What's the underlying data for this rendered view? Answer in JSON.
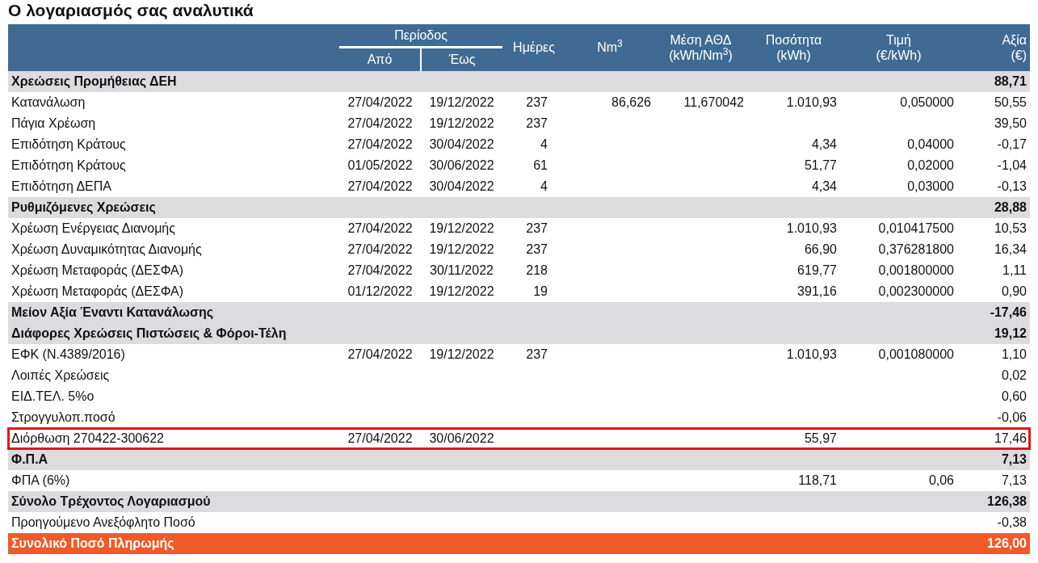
{
  "title": "Ο λογαριασμός σας αναλυτικά",
  "header": {
    "group_label": "Περίοδος",
    "group_columns": [
      "Από",
      "Έως"
    ],
    "columns": [
      [
        "Ημέρες"
      ],
      [
        "Nm$^{3}$"
      ],
      [
        "Μέση ΑΘΔ",
        "(kWh/Nm$^{3}$)"
      ],
      [
        "Ποσότητα",
        "(kWh)"
      ],
      [
        "Τιμή",
        "(€/kWh)"
      ],
      [
        "Αξία",
        "(€)"
      ]
    ]
  },
  "rows": [
    {
      "kind": "section",
      "highlighted": false,
      "label": "Χρεώσεις Προμήθειας ΔΕΗ",
      "value": "88,71"
    },
    {
      "kind": "item",
      "highlighted": false,
      "label": "Κατανάλωση",
      "from": "27/04/2022",
      "to": "19/12/2022",
      "days": "237",
      "nm3": "86,626",
      "athd": "11,670042",
      "qty": "1.010,93",
      "price": "0,050000",
      "value": "50,55"
    },
    {
      "kind": "item",
      "highlighted": false,
      "label": "Πάγια Χρέωση",
      "from": "27/04/2022",
      "to": "19/12/2022",
      "days": "237",
      "value": "39,50"
    },
    {
      "kind": "item",
      "highlighted": false,
      "label": "Επιδότηση Κράτους",
      "from": "27/04/2022",
      "to": "30/04/2022",
      "days": "4",
      "qty": "4,34",
      "price": "0,04000",
      "value": "-0,17"
    },
    {
      "kind": "item",
      "highlighted": false,
      "label": "Επιδότηση Κράτους",
      "from": "01/05/2022",
      "to": "30/06/2022",
      "days": "61",
      "qty": "51,77",
      "price": "0,02000",
      "value": "-1,04"
    },
    {
      "kind": "item",
      "highlighted": false,
      "label": "Επιδότηση ΔΕΠΑ",
      "from": "27/04/2022",
      "to": "30/04/2022",
      "days": "4",
      "qty": "4,34",
      "price": "0,03000",
      "value": "-0,13"
    },
    {
      "kind": "section",
      "highlighted": false,
      "label": "Ρυθμιζόμενες Χρεώσεις",
      "value": "28,88"
    },
    {
      "kind": "item",
      "highlighted": false,
      "label": "Χρέωση Ενέργειας Διανομής",
      "from": "27/04/2022",
      "to": "19/12/2022",
      "days": "237",
      "qty": "1.010,93",
      "price": "0,010417500",
      "value": "10,53"
    },
    {
      "kind": "item",
      "highlighted": false,
      "label": "Χρέωση Δυναμικότητας Διανομής",
      "from": "27/04/2022",
      "to": "19/12/2022",
      "days": "237",
      "qty": "66,90",
      "price": "0,376281800",
      "value": "16,34"
    },
    {
      "kind": "item",
      "highlighted": false,
      "label": "Χρέωση Μεταφοράς (ΔΕΣΦΑ)",
      "from": "27/04/2022",
      "to": "30/11/2022",
      "days": "218",
      "qty": "619,77",
      "price": "0,001800000",
      "value": "1,11"
    },
    {
      "kind": "item",
      "highlighted": false,
      "label": "Χρέωση Μεταφοράς (ΔΕΣΦΑ)",
      "from": "01/12/2022",
      "to": "19/12/2022",
      "days": "19",
      "qty": "391,16",
      "price": "0,002300000",
      "value": "0,90"
    },
    {
      "kind": "section",
      "highlighted": false,
      "label": "Μείον Αξία Έναντι Κατανάλωσης",
      "value": "-17,46"
    },
    {
      "kind": "section",
      "highlighted": false,
      "label": "Διάφορες Χρεώσεις Πιστώσεις & Φόροι-Τέλη",
      "value": "19,12"
    },
    {
      "kind": "item",
      "highlighted": false,
      "label": "ΕΦΚ (Ν.4389/2016)",
      "from": "27/04/2022",
      "to": "19/12/2022",
      "days": "237",
      "qty": "1.010,93",
      "price": "0,001080000",
      "value": "1,10"
    },
    {
      "kind": "item",
      "highlighted": false,
      "label": "Λοιπές Χρεώσεις",
      "value": "0,02"
    },
    {
      "kind": "item",
      "highlighted": false,
      "label": "ΕΙΔ.ΤΕΛ. 5%ο",
      "value": "0,60"
    },
    {
      "kind": "item",
      "highlighted": false,
      "label": "Στρογγυλοπ.ποσό",
      "value": "-0,06"
    },
    {
      "kind": "item",
      "highlighted": true,
      "label": "Διόρθωση 270422-300622",
      "from": "27/04/2022",
      "to": "30/06/2022",
      "qty": "55,97",
      "value": "17,46"
    },
    {
      "kind": "section",
      "highlighted": false,
      "label": "Φ.Π.Α",
      "value": "7,13"
    },
    {
      "kind": "item",
      "highlighted": false,
      "label": "ΦΠΑ (6%)",
      "qty": "118,71",
      "price": "0,06",
      "value": "7,13"
    },
    {
      "kind": "section",
      "highlighted": false,
      "label": "Σύνολο Τρέχοντος Λογαριασμού",
      "value": "126,38"
    },
    {
      "kind": "item",
      "highlighted": false,
      "label": "Προηγούμενο Ανεξόφλητο Ποσό",
      "value": "-0,38"
    },
    {
      "kind": "total",
      "highlighted": false,
      "label": "Συνολικό Ποσό Πληρωμής",
      "value": "126,00"
    }
  ]
}
